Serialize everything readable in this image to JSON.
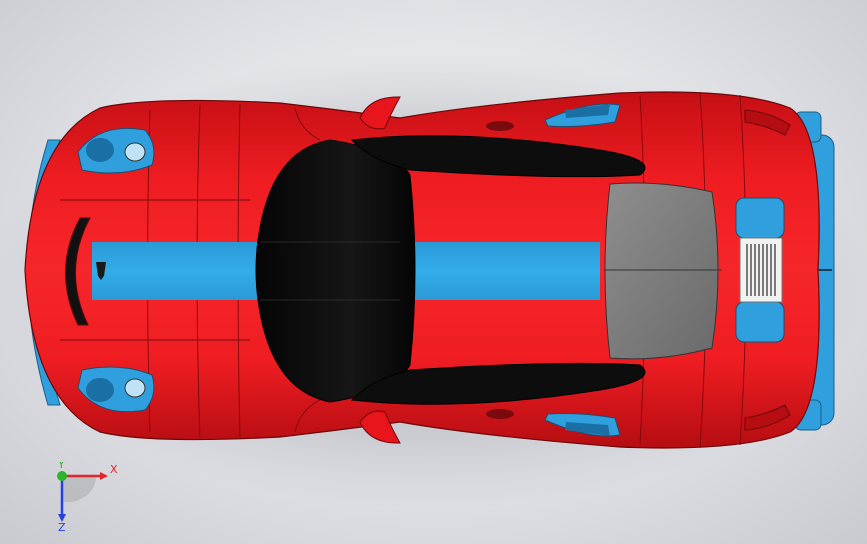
{
  "viewport": {
    "model": "sports-car-top-view",
    "colors": {
      "body": "#e8161c",
      "body_dark": "#b80d12",
      "stripe": "#2aa3df",
      "accent_blue": "#2f9fdc",
      "glass": "#111111",
      "engine_cover": "#7a7a7a",
      "background": "#dcdde1"
    }
  },
  "triad": {
    "x_label": "X",
    "y_label": "Y",
    "z_label": "Z",
    "x_color": "#e0242a",
    "y_color": "#2bb52b",
    "z_color": "#2a3fe0"
  }
}
